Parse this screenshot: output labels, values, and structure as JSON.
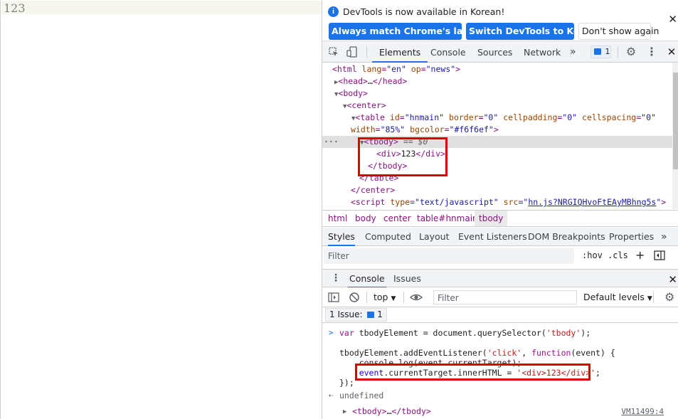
{
  "page": {
    "text": "123"
  },
  "infobar": {
    "message": "DevTools is now available in Korean!",
    "buttons": [
      "Always match Chrome's language",
      "Switch DevTools to Korean",
      "Don't show again"
    ],
    "close": "✕"
  },
  "toolbar": {
    "tabs": [
      "Elements",
      "Console",
      "Sources",
      "Network"
    ],
    "active_tab": "Elements",
    "more": "»",
    "issues_badge": "1"
  },
  "dom": {
    "lines": [
      "<html lang=\"en\" op=\"news\">",
      "<head>…</head>",
      "<body>",
      "<center>",
      "<table id=\"hnmain\" border=\"0\" cellpadding=\"0\" cellspacing=\"0\"",
      "width=\"85%\" bgcolor=\"#f6f6ef\">",
      "<tbody> == $0",
      "<div>123</div>",
      "</tbody>",
      "</table>",
      "</center>",
      "<script type=\"text/javascript\" src=\"hn.js?NRGIQHvoFtEAyMBhng5s\">"
    ]
  },
  "breadcrumbs": [
    "html",
    "body",
    "center",
    "table#hnmain",
    "tbody"
  ],
  "styles_tabs": [
    "Styles",
    "Computed",
    "Layout",
    "Event Listeners",
    "DOM Breakpoints",
    "Properties"
  ],
  "styles_filter": {
    "placeholder": "Filter",
    "hov": ":hov",
    "cls": ".cls",
    "add": "+"
  },
  "drawer": {
    "tabs": [
      "Console",
      "Issues"
    ],
    "context": "top",
    "filter_placeholder": "Filter",
    "levels": "Default levels",
    "issues_label": "1 Issue:",
    "issues_count": "1"
  },
  "console": {
    "lines": [
      "var tbodyElement = document.querySelector('tbody');",
      "",
      "tbodyElement.addEventListener('click', function(event) {",
      "    console.log(event.currentTarget);",
      "    event.currentTarget.innerHTML = '<div>123</div>';",
      "});"
    ],
    "result": "undefined",
    "output": "<tbody>…</tbody>",
    "source_link": "VM11499:4"
  },
  "colors": {
    "accent": "#1a73e8",
    "highlight_box": "#e00000",
    "page_bg": "#f6f6ef"
  }
}
